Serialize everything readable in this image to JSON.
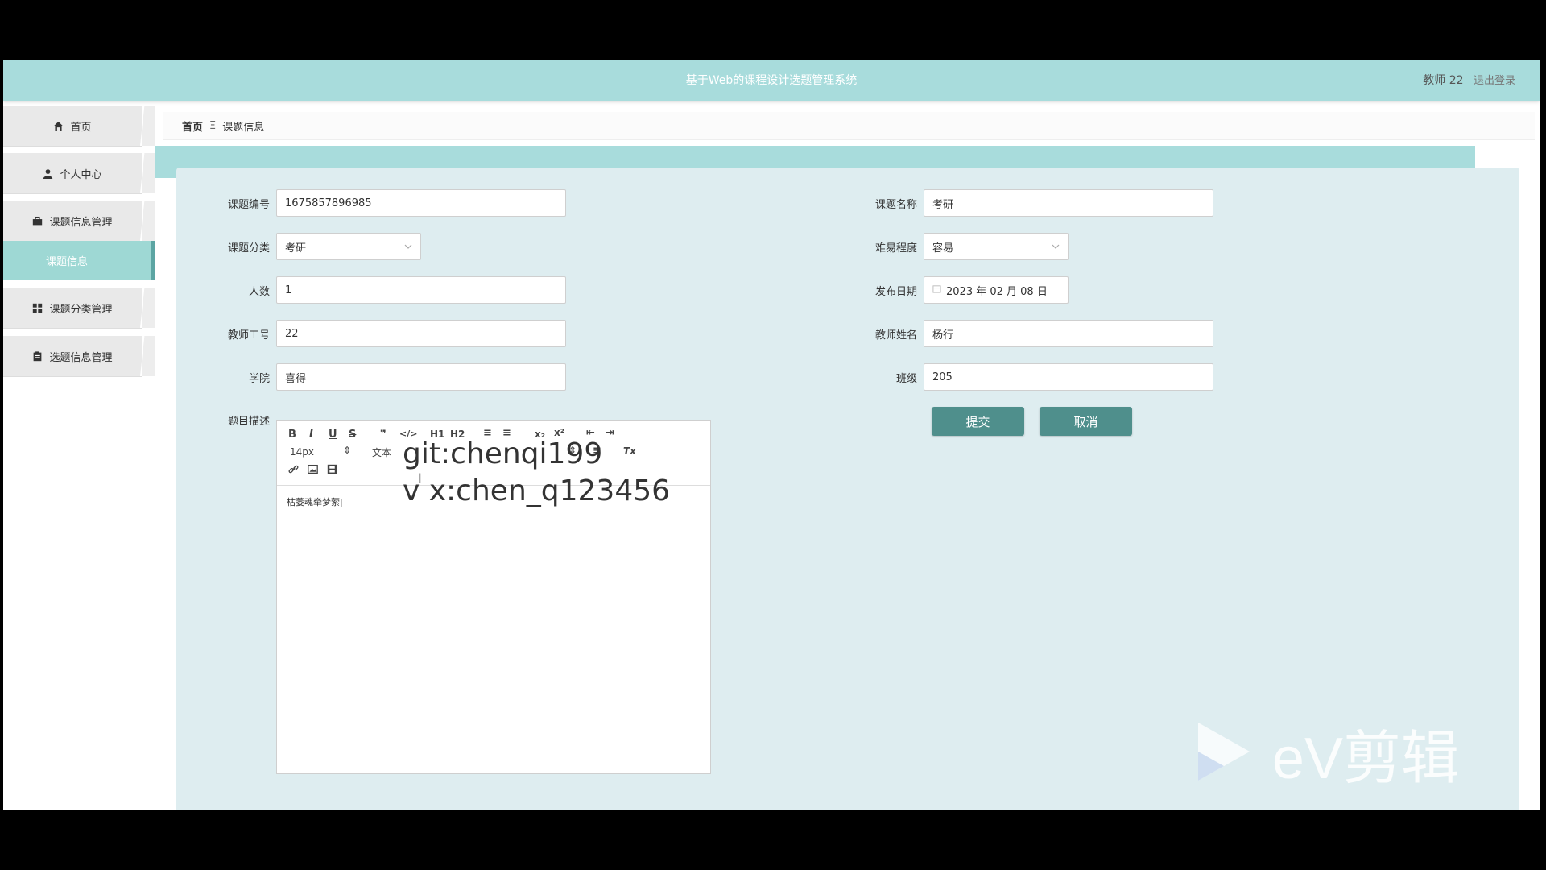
{
  "app": {
    "title": "基于Web的课程设计选题管理系统",
    "user": "教师 22",
    "logout": "退出登录"
  },
  "sidebar": {
    "items": [
      {
        "label": "首页",
        "icon": "home-icon"
      },
      {
        "label": "个人中心",
        "icon": "user-icon"
      },
      {
        "label": "课题信息管理",
        "icon": "briefcase-icon"
      },
      {
        "label": "课题信息",
        "icon": "",
        "active": true
      },
      {
        "label": "课题分类管理",
        "icon": "grid-icon"
      },
      {
        "label": "选题信息管理",
        "icon": "clipboard-icon"
      }
    ]
  },
  "breadcrumb": {
    "home": "首页",
    "sep": "Ξ",
    "current": "课题信息"
  },
  "form": {
    "topic_id": {
      "label": "课题编号",
      "value": "1675857896985"
    },
    "topic_name": {
      "label": "课题名称",
      "value": "考研"
    },
    "category": {
      "label": "课题分类",
      "value": "考研"
    },
    "difficulty": {
      "label": "难易程度",
      "value": "容易"
    },
    "count": {
      "label": "人数",
      "value": "1"
    },
    "publish_date": {
      "label": "发布日期",
      "value": "2023 年 02 月 08 日"
    },
    "teacher_id": {
      "label": "教师工号",
      "value": "22"
    },
    "teacher_name": {
      "label": "教师姓名",
      "value": "杨行"
    },
    "college": {
      "label": "学院",
      "value": "喜得"
    },
    "class": {
      "label": "班级",
      "value": "205"
    },
    "description": {
      "label": "题目描述",
      "value": "枯萎魂牵梦萦|"
    },
    "submit": "提交",
    "cancel": "取消"
  },
  "editor": {
    "font_size": "14px",
    "text_style": "文本",
    "toolbar": {
      "bold": "B",
      "italic": "I",
      "underline": "U",
      "strike": "S",
      "quote": "❞",
      "code": "</>",
      "h1": "H1",
      "h2": "H2",
      "ol": "≡",
      "ul": "≡",
      "sub": "x₂",
      "sup": "x²",
      "indent_dec": "⇤",
      "indent_inc": "⇥",
      "align": "≡",
      "clean": "Tx"
    }
  },
  "overlay": {
    "line1": "git:chenqi199",
    "line2": "v x:chen_q123456",
    "watermark": "eV剪辑"
  },
  "colors": {
    "topbar": "#a8dcdc",
    "panel": "#deedf0",
    "button": "#4f8f8c",
    "active_menu": "#9ed8d4"
  }
}
